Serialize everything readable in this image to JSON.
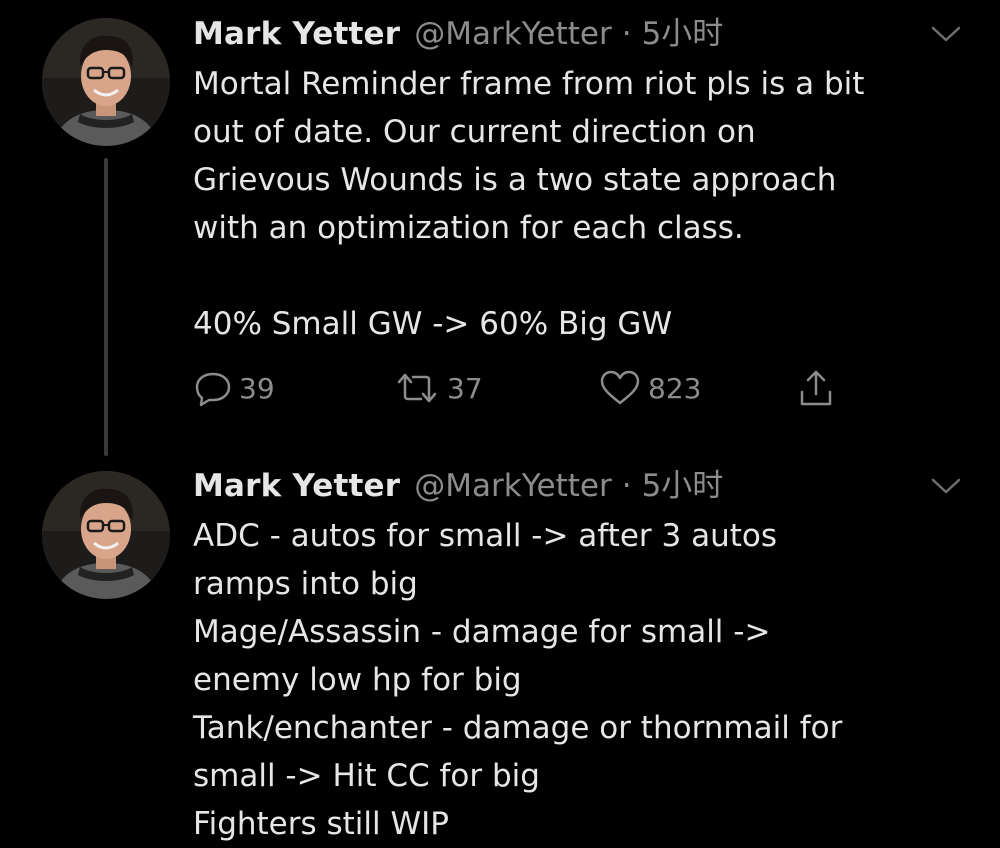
{
  "tweets": [
    {
      "author_name": "Mark Yetter",
      "handle": "@MarkYetter",
      "separator": "·",
      "time": "5小时",
      "text": "Mortal Reminder frame from riot pls is a bit\nout of date. Our current direction on\nGrievous Wounds is a two state approach\nwith an optimization for each class.\n\n40% Small GW -> 60% Big GW",
      "replies": "39",
      "retweets": "37",
      "likes": "823"
    },
    {
      "author_name": "Mark Yetter",
      "handle": "@MarkYetter",
      "separator": "·",
      "time": "5小时",
      "text": "ADC - autos for small -> after 3 autos\nramps into big\nMage/Assassin - damage for small ->\nenemy low hp for big\nTank/enchanter - damage or thornmail for\nsmall -> Hit CC for big\nFighters still WIP"
    }
  ],
  "icons": {
    "reply": "reply-icon",
    "retweet": "retweet-icon",
    "like": "heart-icon",
    "share": "share-icon",
    "more": "chevron-down-icon"
  },
  "colors": {
    "background": "#000000",
    "primary_text": "#e6e6e6",
    "secondary_text": "#8c8c8c",
    "thread_line": "#3a3a3a"
  }
}
